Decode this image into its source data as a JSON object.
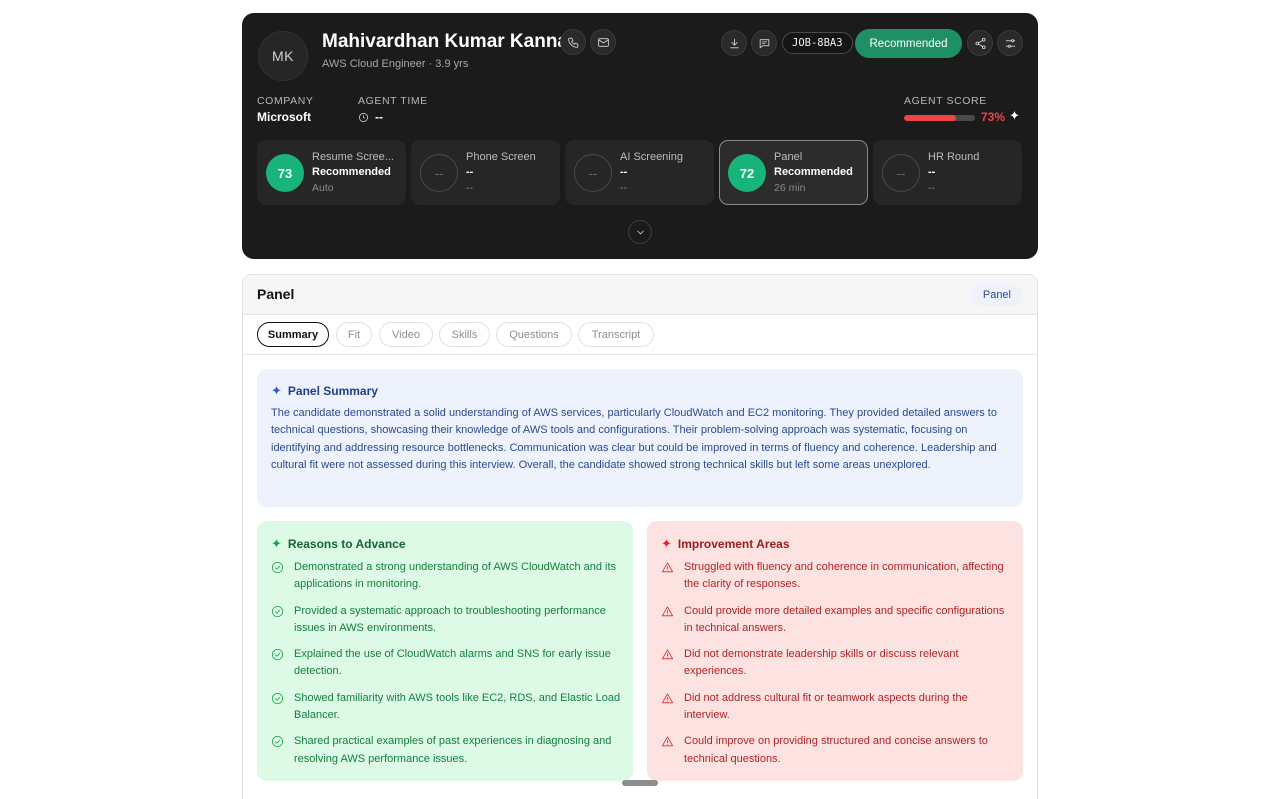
{
  "candidate": {
    "initials": "MK",
    "name": "Mahivardhan Kumar Kanna",
    "subtitle": "AWS Cloud Engineer · 3.9 yrs",
    "job_id": "JOB-8BA3",
    "status_button": "Recommended"
  },
  "meta": {
    "company_label": "COMPANY",
    "company_value": "Microsoft",
    "agent_time_label": "AGENT TIME",
    "agent_time_value": "--",
    "agent_score_label": "AGENT SCORE",
    "agent_score_value": "73%",
    "agent_score_fraction": 0.73
  },
  "stages": [
    {
      "score": "73",
      "title": "Resume Scree...",
      "status": "Recommended",
      "meta": "Auto"
    },
    {
      "score": "--",
      "title": "Phone Screen",
      "status": "--",
      "meta": "--"
    },
    {
      "score": "--",
      "title": "AI Screening",
      "status": "--",
      "meta": "--"
    },
    {
      "score": "72",
      "title": "Panel",
      "status": "Recommended",
      "meta": "26 min"
    },
    {
      "score": "--",
      "title": "HR Round",
      "status": "--",
      "meta": "--"
    }
  ],
  "panel": {
    "title": "Panel",
    "badge": "Panel",
    "tabs": [
      "Summary",
      "Fit",
      "Video",
      "Skills",
      "Questions",
      "Transcript"
    ],
    "summary_title": "Panel Summary",
    "summary_text": "The candidate demonstrated a solid understanding of AWS services, particularly CloudWatch and EC2 monitoring. They provided detailed answers to technical questions, showcasing their knowledge of AWS tools and configurations. Their problem-solving approach was systematic, focusing on identifying and addressing resource bottlenecks. Communication was clear but could be improved in terms of fluency and coherence. Leadership and cultural fit were not assessed during this interview. Overall, the candidate showed strong technical skills but left some areas unexplored.",
    "reasons_title": "Reasons to Advance",
    "reasons": [
      "Demonstrated a strong understanding of AWS CloudWatch and its applications in monitoring.",
      "Provided a systematic approach to troubleshooting performance issues in AWS environments.",
      "Explained the use of CloudWatch alarms and SNS for early issue detection.",
      "Showed familiarity with AWS tools like EC2, RDS, and Elastic Load Balancer.",
      "Shared practical examples of past experiences in diagnosing and resolving AWS performance issues."
    ],
    "improvements_title": "Improvement Areas",
    "improvements": [
      "Struggled with fluency and coherence in communication, affecting the clarity of responses.",
      "Could provide more detailed examples and specific configurations in technical answers.",
      "Did not demonstrate leadership skills or discuss relevant experiences.",
      "Did not address cultural fit or teamwork aspects during the interview.",
      "Could improve on providing structured and concise answers to technical questions."
    ]
  },
  "colors": {
    "accent_green": "#1f8f66",
    "score_red": "#ef4444",
    "dark_bg": "#1b1b1c"
  }
}
